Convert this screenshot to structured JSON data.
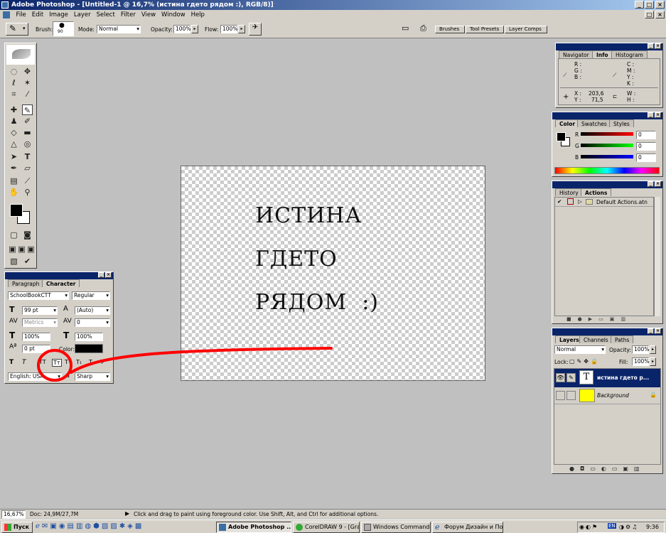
{
  "window": {
    "title": "Adobe Photoshop - [Untitled-1 @ 16,7% (истина гдето рядом :), RGB/8)]"
  },
  "menu": [
    "File",
    "Edit",
    "Image",
    "Layer",
    "Select",
    "Filter",
    "View",
    "Window",
    "Help"
  ],
  "options": {
    "brush_label": "Brush:",
    "brush_size": "90",
    "mode_label": "Mode:",
    "mode_value": "Normal",
    "opacity_label": "Opacity:",
    "opacity_value": "100%",
    "flow_label": "Flow:",
    "flow_value": "100%"
  },
  "well_tabs": [
    "Brushes",
    "Tool Presets",
    "Layer Comps"
  ],
  "navigator": {
    "tabs": [
      "Navigator",
      "Info",
      "Histogram"
    ],
    "r": "R :",
    "g": "G :",
    "b": "B :",
    "c": "C :",
    "m": "M :",
    "y_cmyk": "Y :",
    "k": "K :",
    "x_label": "X :",
    "x_value": "203,6",
    "y_label": "Y :",
    "y_value": "71,5",
    "w": "W :",
    "h": "H :"
  },
  "color": {
    "tabs": [
      "Color",
      "Swatches",
      "Styles"
    ],
    "r_label": "R",
    "g_label": "G",
    "b_label": "B",
    "r_value": "0",
    "g_value": "0",
    "b_value": "0"
  },
  "history": {
    "tabs": [
      "History",
      "Actions"
    ],
    "item": "Default Actions.atn"
  },
  "layers": {
    "tabs": [
      "Layers",
      "Channels",
      "Paths"
    ],
    "blend": "Normal",
    "opacity_label": "Opacity:",
    "opacity": "100%",
    "lock_label": "Lock:",
    "fill_label": "Fill:",
    "fill": "100%",
    "items": [
      {
        "name": "истина гдето р...",
        "thumb": "T"
      },
      {
        "name": "Background",
        "thumb": ""
      }
    ]
  },
  "character": {
    "tabs": [
      "Paragraph",
      "Character"
    ],
    "font": "SchoolBookCTT",
    "style": "Regular",
    "size": "99 pt",
    "leading": "(Auto)",
    "kerning": "Metrics",
    "tracking": "0",
    "vscale": "100%",
    "hscale": "100%",
    "baseline": "0 pt",
    "color_label": "Color:",
    "language": "English: USA",
    "antialias": "Sharp",
    "style_buttons": [
      "T",
      "T",
      "TT",
      "Tт",
      "T¹",
      "T₁",
      "T",
      "T"
    ]
  },
  "canvas": {
    "lines": [
      "ИСТИНА",
      "ГДЕТО",
      "РЯДОМ  :)"
    ]
  },
  "status": {
    "zoom": "16,67%",
    "doc": "Doc: 24,9M/27,7M",
    "hint": "Click and drag to paint using foreground color.  Use Shift, Alt, and Ctrl for additional options."
  },
  "taskbar": {
    "start": "Пуск",
    "tasks": [
      "Adobe Photoshop ...",
      "CorelDRAW 9 - [Gra...",
      "Windows Commande...",
      "Форум Дизайн и По..."
    ],
    "clock": "9:36",
    "lang": "EN"
  },
  "colors": {
    "accent": "#0a246a",
    "annotation": "#ff0000",
    "layer_selected": "#0a246a",
    "bg_layer": "#ffff00"
  }
}
